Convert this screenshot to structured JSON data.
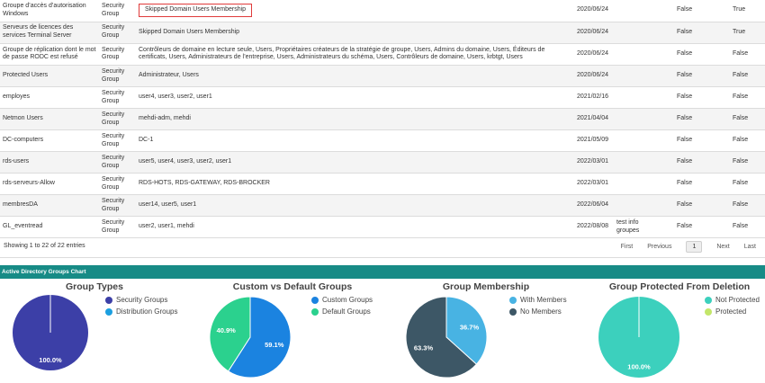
{
  "table": {
    "rows": [
      {
        "name": "Groupe d’accès d’autorisation Windows",
        "type": "Security Group",
        "members": "Skipped Domain Users Membership",
        "date": "2020/06/24",
        "desc": "",
        "c1": "False",
        "c2": "True",
        "highlight": true
      },
      {
        "name": "Serveurs de licences des services Terminal Server",
        "type": "Security Group",
        "members": "Skipped Domain Users Membership",
        "date": "2020/06/24",
        "desc": "",
        "c1": "False",
        "c2": "True"
      },
      {
        "name": "Groupe de réplication dont le mot de passe RODC est refusé",
        "type": "Security Group",
        "members": "Contrôleurs de domaine en lecture seule, Users, Propriétaires créateurs de la stratégie de groupe, Users, Admins du domaine, Users, Éditeurs de certificats, Users, Administrateurs de l’entreprise, Users, Administrateurs du schéma, Users, Contrôleurs de domaine, Users, krbtgt, Users",
        "date": "2020/06/24",
        "desc": "",
        "c1": "False",
        "c2": "False"
      },
      {
        "name": "Protected Users",
        "type": "Security Group",
        "members": "Administrateur, Users",
        "date": "2020/06/24",
        "desc": "",
        "c1": "False",
        "c2": "False"
      },
      {
        "name": "employes",
        "type": "Security Group",
        "members": "user4, user3, user2, user1",
        "date": "2021/02/16",
        "desc": "",
        "c1": "False",
        "c2": "False"
      },
      {
        "name": "Netmon Users",
        "type": "Security Group",
        "members": "mehdi-adm, mehdi",
        "date": "2021/04/04",
        "desc": "",
        "c1": "False",
        "c2": "False"
      },
      {
        "name": "DC-computers",
        "type": "Security Group",
        "members": "DC-1",
        "date": "2021/05/09",
        "desc": "",
        "c1": "False",
        "c2": "False"
      },
      {
        "name": "rds-users",
        "type": "Security Group",
        "members": "user5, user4, user3, user2, user1",
        "date": "2022/03/01",
        "desc": "",
        "c1": "False",
        "c2": "False"
      },
      {
        "name": "rds-serveurs-Allow",
        "type": "Security Group",
        "members": "RDS-HOTS, RDS-GATEWAY, RDS-BROCKER",
        "date": "2022/03/01",
        "desc": "",
        "c1": "False",
        "c2": "False"
      },
      {
        "name": "membresDA",
        "type": "Security Group",
        "members": "user14, user5, user1",
        "date": "2022/06/04",
        "desc": "",
        "c1": "False",
        "c2": "False"
      },
      {
        "name": "GL_eventread",
        "type": "Security Group",
        "members": "user2, user1, mehdi",
        "date": "2022/08/08",
        "desc": "test info groupes",
        "c1": "False",
        "c2": "False"
      }
    ]
  },
  "footer": {
    "info": "Showing 1 to 22 of 22 entries",
    "first": "First",
    "previous": "Previous",
    "page": "1",
    "next": "Next",
    "last": "Last"
  },
  "section_title": "Active Directory Groups Chart",
  "colors": {
    "security": "#3c3fa7",
    "distribution": "#1b9fe0",
    "custom": "#1b83e0",
    "default": "#2bd18e",
    "with_members": "#48b3e3",
    "no_members": "#3d5766",
    "not_protected": "#3cd0bd",
    "protected": "#c3e66a",
    "accent": "#178b86"
  },
  "chart_data": [
    {
      "type": "pie",
      "title": "Group Types",
      "labels": [
        "Security Groups",
        "Distribution Groups"
      ],
      "values": [
        100.0,
        0.0
      ],
      "data_labels": [
        "100.0%"
      ]
    },
    {
      "type": "pie",
      "title": "Custom vs Default Groups",
      "labels": [
        "Custom Groups",
        "Default Groups"
      ],
      "values": [
        59.1,
        40.9
      ],
      "data_labels": [
        "59.1%",
        "40.9%"
      ]
    },
    {
      "type": "pie",
      "title": "Group Membership",
      "labels": [
        "With Members",
        "No Members"
      ],
      "values": [
        36.7,
        63.3
      ],
      "data_labels": [
        "36.7%",
        "63.3%"
      ]
    },
    {
      "type": "pie",
      "title": "Group Protected From Deletion",
      "labels": [
        "Not Protected",
        "Protected"
      ],
      "values": [
        100.0,
        0.0
      ],
      "data_labels": [
        "100.0%"
      ]
    }
  ]
}
